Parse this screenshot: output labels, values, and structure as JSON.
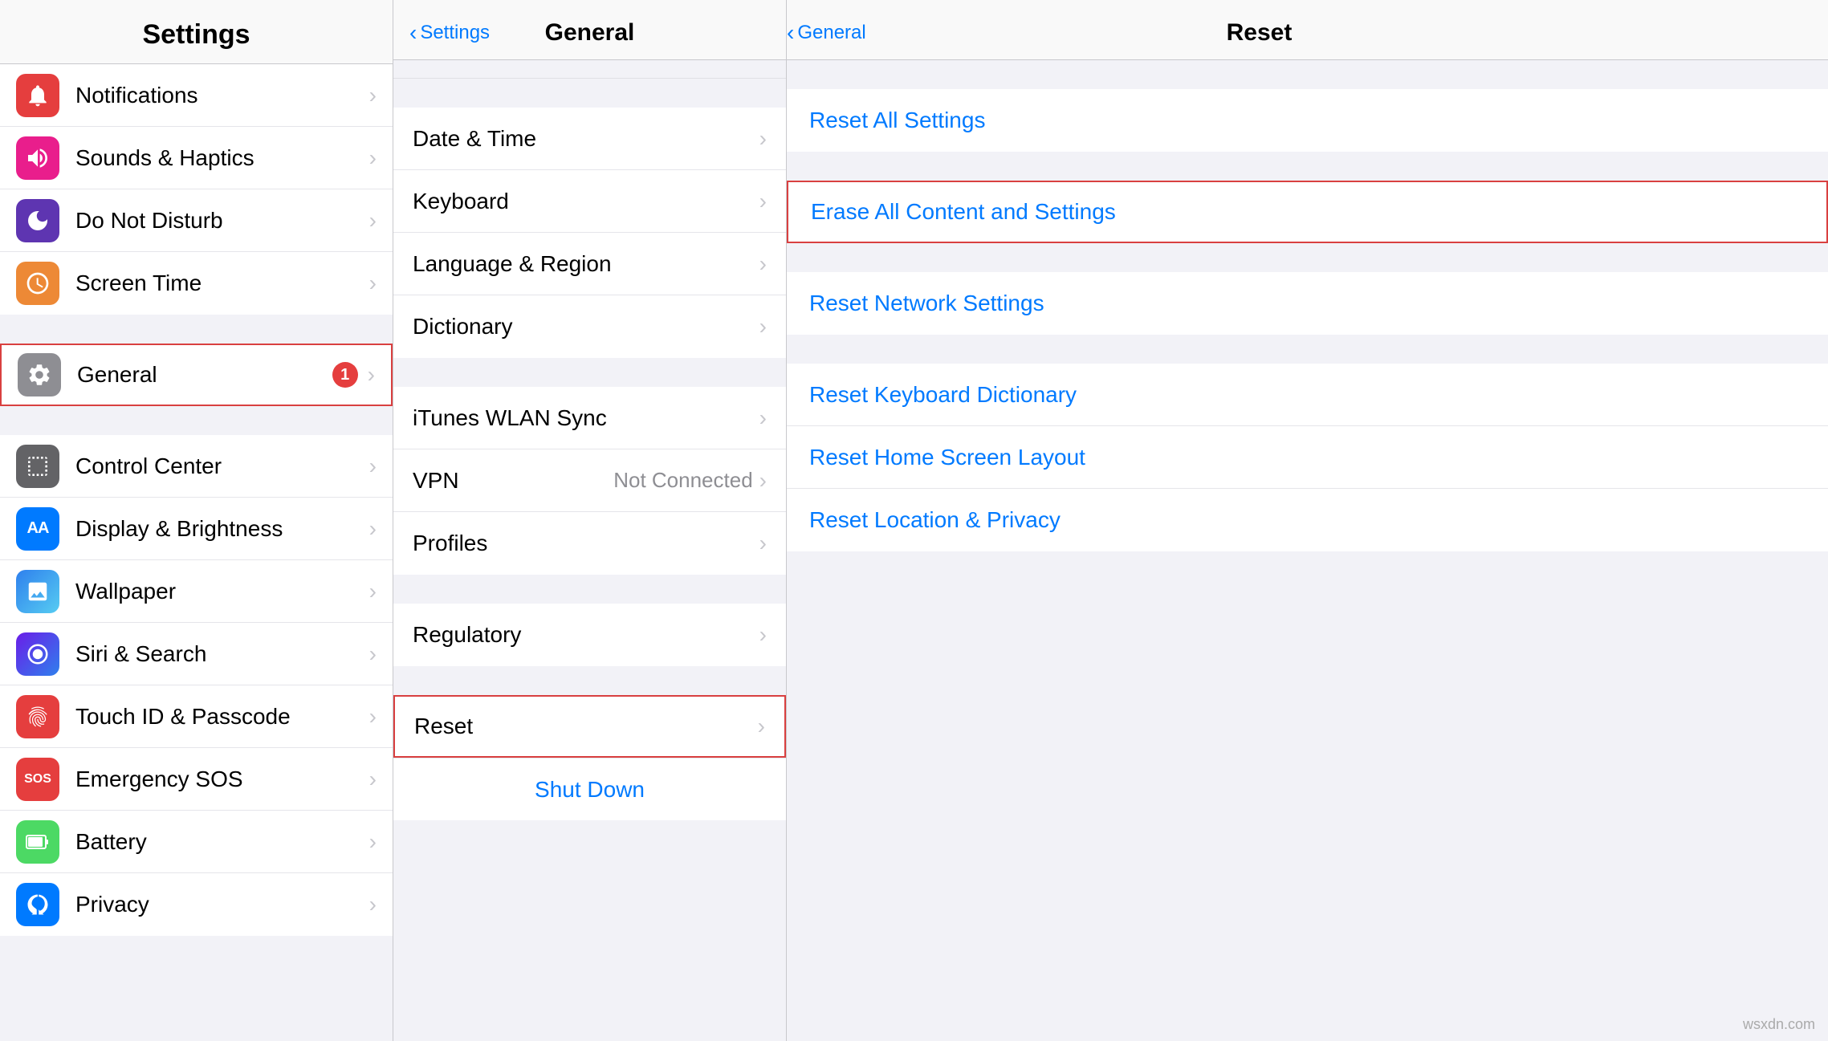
{
  "settings_col": {
    "title": "Settings",
    "items_group1": [
      {
        "id": "notifications",
        "label": "Notifications",
        "icon_class": "icon-red",
        "icon_char": "🔔",
        "badge": null,
        "selected": false
      },
      {
        "id": "sounds",
        "label": "Sounds & Haptics",
        "icon_class": "icon-pink",
        "icon_char": "🔊",
        "badge": null,
        "selected": false
      },
      {
        "id": "donotdisturb",
        "label": "Do Not Disturb",
        "icon_class": "icon-purple",
        "icon_char": "🌙",
        "badge": null,
        "selected": false
      },
      {
        "id": "screentime",
        "label": "Screen Time",
        "icon_class": "icon-orange",
        "icon_char": "⏱",
        "badge": null,
        "selected": false
      }
    ],
    "items_group2": [
      {
        "id": "general",
        "label": "General",
        "icon_class": "icon-gray",
        "icon_char": "⚙",
        "badge": "1",
        "selected": true
      }
    ],
    "items_group3": [
      {
        "id": "controlcenter",
        "label": "Control Center",
        "icon_class": "icon-darkgray",
        "icon_char": "⊞",
        "badge": null,
        "selected": false
      },
      {
        "id": "displaybrightness",
        "label": "Display & Brightness",
        "icon_class": "icon-blue",
        "icon_char": "AA",
        "badge": null,
        "selected": false
      },
      {
        "id": "wallpaper",
        "label": "Wallpaper",
        "icon_class": "icon-wallpaper",
        "icon_char": "❋",
        "badge": null,
        "selected": false
      },
      {
        "id": "sirisearch",
        "label": "Siri & Search",
        "icon_class": "icon-siri",
        "icon_char": "◎",
        "badge": null,
        "selected": false
      },
      {
        "id": "touchid",
        "label": "Touch ID & Passcode",
        "icon_class": "icon-red",
        "icon_char": "◉",
        "badge": null,
        "selected": false
      },
      {
        "id": "emergencysos",
        "label": "Emergency SOS",
        "icon_class": "icon-sos",
        "icon_char": "SOS",
        "badge": null,
        "selected": false
      },
      {
        "id": "battery",
        "label": "Battery",
        "icon_class": "icon-green",
        "icon_char": "▮",
        "badge": null,
        "selected": false
      },
      {
        "id": "privacy",
        "label": "Privacy",
        "icon_class": "icon-blue",
        "icon_char": "✋",
        "badge": null,
        "selected": false
      }
    ]
  },
  "general_col": {
    "back_label": "Settings",
    "title": "General",
    "items_group1": [
      {
        "id": "datetime",
        "label": "Date & Time",
        "value": "",
        "selected": false
      },
      {
        "id": "keyboard",
        "label": "Keyboard",
        "value": "",
        "selected": false
      },
      {
        "id": "language",
        "label": "Language & Region",
        "value": "",
        "selected": false
      },
      {
        "id": "dictionary",
        "label": "Dictionary",
        "value": "",
        "selected": false
      }
    ],
    "items_group2": [
      {
        "id": "ituneswlan",
        "label": "iTunes WLAN Sync",
        "value": "",
        "selected": false
      },
      {
        "id": "vpn",
        "label": "VPN",
        "value": "Not Connected",
        "selected": false
      },
      {
        "id": "profiles",
        "label": "Profiles",
        "value": "",
        "selected": false
      }
    ],
    "items_group3": [
      {
        "id": "regulatory",
        "label": "Regulatory",
        "value": "",
        "selected": false
      }
    ],
    "items_group4": [
      {
        "id": "reset",
        "label": "Reset",
        "value": "",
        "selected": true
      }
    ],
    "shutdown_label": "Shut Down"
  },
  "reset_col": {
    "back_label": "General",
    "title": "Reset",
    "items_group1": [
      {
        "id": "resetallsettings",
        "label": "Reset All Settings",
        "highlighted": false
      }
    ],
    "items_group2": [
      {
        "id": "eraseall",
        "label": "Erase All Content and Settings",
        "highlighted": true
      }
    ],
    "items_group3": [
      {
        "id": "resetnetwork",
        "label": "Reset Network Settings",
        "highlighted": false
      }
    ],
    "items_group4": [
      {
        "id": "resetkeyboard",
        "label": "Reset Keyboard Dictionary",
        "highlighted": false
      },
      {
        "id": "resethome",
        "label": "Reset Home Screen Layout",
        "highlighted": false
      },
      {
        "id": "resetlocation",
        "label": "Reset Location & Privacy",
        "highlighted": false
      }
    ]
  },
  "watermark": "wsxdn.com"
}
